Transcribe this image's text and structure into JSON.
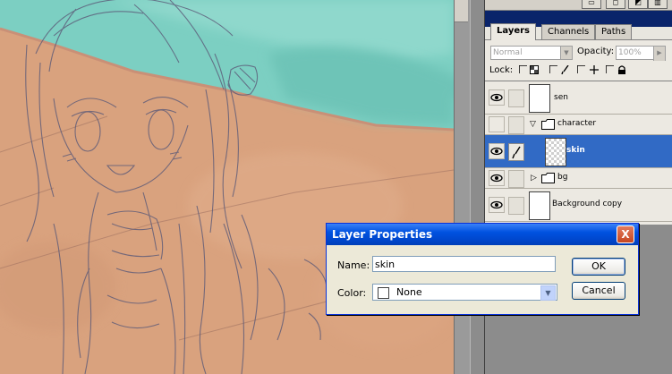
{
  "palette": {
    "tabs": [
      {
        "label": "Layers",
        "active": true
      },
      {
        "label": "Channels",
        "active": false
      },
      {
        "label": "Paths",
        "active": false
      }
    ],
    "blend_mode": "Normal",
    "opacity_label": "Opacity:",
    "opacity_value": "100%",
    "lock_label": "Lock:",
    "layers": [
      {
        "name": "sen",
        "visible": true,
        "type": "layer",
        "selected": false
      },
      {
        "name": "character",
        "visible": false,
        "type": "group",
        "expanded": true,
        "selected": false
      },
      {
        "name": "skin",
        "visible": true,
        "type": "layer",
        "selected": true
      },
      {
        "name": "bg",
        "visible": true,
        "type": "group",
        "expanded": false,
        "selected": false
      },
      {
        "name": "Background copy",
        "visible": true,
        "type": "layer",
        "selected": false
      }
    ]
  },
  "dialog": {
    "title": "Layer Properties",
    "close_label": "X",
    "name_label": "Name:",
    "name_value": "skin",
    "color_label": "Color:",
    "color_value": "None",
    "ok_label": "OK",
    "cancel_label": "Cancel"
  },
  "colors": {
    "canvas_skin": "#d9a27e",
    "canvas_water": "#7ccfc2",
    "selection": "#316ac5",
    "xp_title": "#0052e0"
  }
}
